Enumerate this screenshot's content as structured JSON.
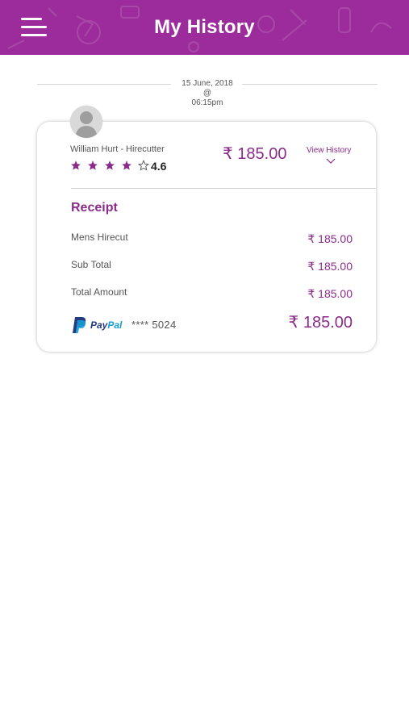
{
  "header": {
    "title": "My History",
    "menu_icon": "hamburger-menu-icon",
    "background_color": "#9c2c9c"
  },
  "history": {
    "date": "15 June, 2018",
    "at": "@",
    "time": "06:15pm"
  },
  "card": {
    "provider_name": "William Hurt - Hirecutter",
    "rating_value": "4.6",
    "stars_filled": 4,
    "stars_total": 5,
    "amount": "₹ 185.00",
    "view_history_label": "View History",
    "receipt_title": "Receipt",
    "rows": [
      {
        "label": "Mens Hirecut",
        "value": "₹ 185.00"
      },
      {
        "label": "Sub Total",
        "value": "₹ 185.00"
      },
      {
        "label": "Total Amount",
        "value": "₹ 185.00"
      }
    ],
    "payment": {
      "brand_part1": "Pay",
      "brand_part2": "Pal",
      "card_masked": "**** 5024",
      "total": "₹ 185.00"
    },
    "accent_color": "#8a2b8a"
  }
}
